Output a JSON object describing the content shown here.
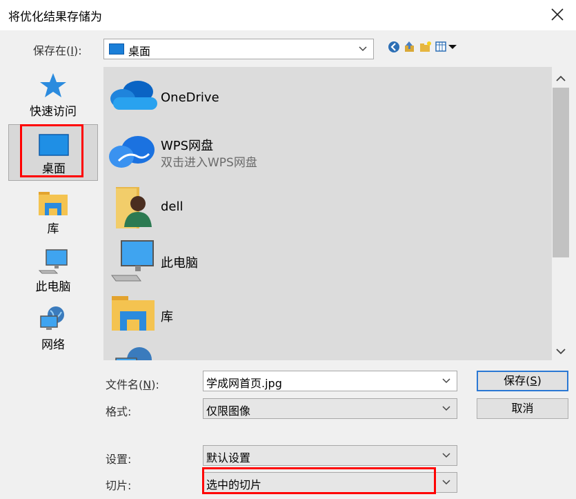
{
  "dialog": {
    "title": "将优化结果存储为"
  },
  "lookin": {
    "label_prefix": "保存在(",
    "label_key": "I",
    "label_suffix": "):",
    "value": "桌面"
  },
  "toolbar": {
    "icons": [
      "back-icon",
      "up-folder-icon",
      "new-folder-icon",
      "view-menu-icon"
    ]
  },
  "places": [
    {
      "label": "快速访问",
      "icon": "star-icon"
    },
    {
      "label": "桌面",
      "icon": "desktop-icon",
      "selected": true
    },
    {
      "label": "库",
      "icon": "library-icon"
    },
    {
      "label": "此电脑",
      "icon": "computer-icon"
    },
    {
      "label": "网络",
      "icon": "network-icon"
    }
  ],
  "files": [
    {
      "name": "OneDrive",
      "subtitle": "",
      "icon": "onedrive-cloud-icon"
    },
    {
      "name": "WPS网盘",
      "subtitle": "双击进入WPS网盘",
      "icon": "wps-cloud-icon"
    },
    {
      "name": "dell",
      "subtitle": "",
      "icon": "user-folder-icon"
    },
    {
      "name": "此电脑",
      "subtitle": "",
      "icon": "computer-icon"
    },
    {
      "name": "库",
      "subtitle": "",
      "icon": "library-icon"
    }
  ],
  "form": {
    "filename": {
      "label_prefix": "文件名(",
      "label_key": "N",
      "label_suffix": "):",
      "value": "学成网首页.jpg"
    },
    "format": {
      "label": "格式:",
      "value": "仅限图像"
    },
    "settings": {
      "label": "设置:",
      "value": "默认设置"
    },
    "slices": {
      "label": "切片:",
      "value": "选中的切片"
    }
  },
  "buttons": {
    "save": {
      "text": "保存(",
      "key": "S",
      "suffix": ")"
    },
    "cancel": {
      "text": "取消"
    }
  },
  "colors": {
    "highlight_box": "#ff0000",
    "default_button_border": "#2a78d4"
  }
}
